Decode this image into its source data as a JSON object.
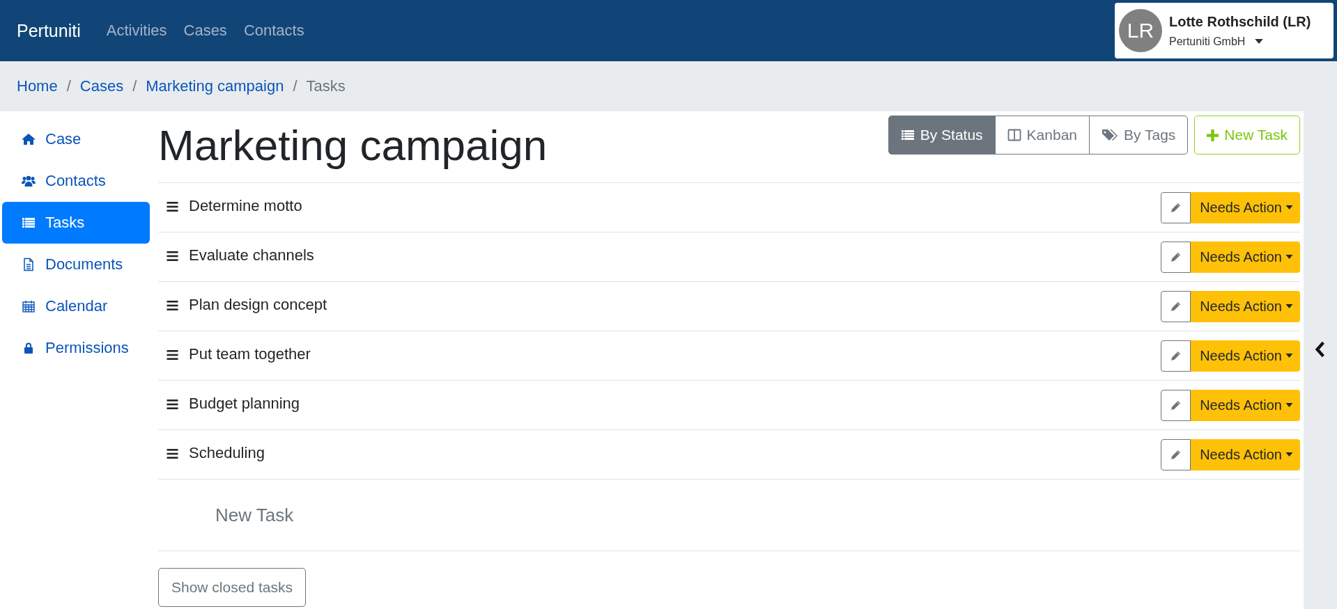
{
  "navbar": {
    "brand": "Pertuniti",
    "links": [
      {
        "label": "Activities"
      },
      {
        "label": "Cases"
      },
      {
        "label": "Contacts"
      }
    ],
    "user": {
      "initials": "LR",
      "name": "Lotte Rothschild (LR)",
      "company": "Pertuniti GmbH"
    }
  },
  "breadcrumb": [
    {
      "label": "Home",
      "current": false
    },
    {
      "separator": "/",
      "label": "Cases",
      "current": false
    },
    {
      "separator": "/",
      "label": "Marketing campaign",
      "current": false
    },
    {
      "separator": "/",
      "label": "Tasks",
      "current": true
    }
  ],
  "sidebar": {
    "items": [
      {
        "label": "Case",
        "kind": "home",
        "selected": false
      },
      {
        "label": "Contacts",
        "kind": "users",
        "selected": false
      },
      {
        "label": "Tasks",
        "kind": "list",
        "selected": true
      },
      {
        "label": "Documents",
        "kind": "file",
        "selected": false
      },
      {
        "label": "Calendar",
        "kind": "calendar",
        "selected": false
      },
      {
        "label": "Permissions",
        "kind": "lock",
        "selected": false
      }
    ]
  },
  "title": "Marketing campaign",
  "view_buttons": [
    {
      "label": "By Status",
      "kind": "list",
      "selected": true
    },
    {
      "label": "Kanban",
      "kind": "columns",
      "selected": false
    },
    {
      "label": "By Tags",
      "kind": "tags",
      "selected": false
    }
  ],
  "new_task_button": "New Task",
  "tasks": [
    {
      "title": "Determine motto",
      "status": "Needs Action"
    },
    {
      "title": "Evaluate channels",
      "status": "Needs Action"
    },
    {
      "title": "Plan design concept",
      "status": "Needs Action"
    },
    {
      "title": "Put team together",
      "status": "Needs Action"
    },
    {
      "title": "Budget planning",
      "status": "Needs Action"
    },
    {
      "title": "Scheduling",
      "status": "Needs Action"
    }
  ],
  "new_task_field": {
    "placeholder": "New Task"
  },
  "show_closed_button": "Show closed tasks"
}
